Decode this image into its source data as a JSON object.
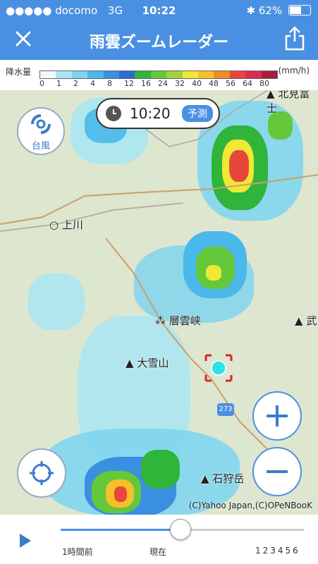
{
  "status": {
    "carrier": "●●●●● docomo",
    "network": "3G",
    "time": "10:22",
    "battery": "62%",
    "battery_level": 0.62
  },
  "nav": {
    "title": "雨雲ズームレーダー"
  },
  "legend": {
    "label": "降水量",
    "unit": "(mm/h)",
    "ticks": [
      "0",
      "1",
      "2",
      "4",
      "8",
      "12",
      "16",
      "24",
      "32",
      "40",
      "48",
      "56",
      "64",
      "80"
    ],
    "colors": [
      "#f2f7ff",
      "#a8e6f5",
      "#7dd3f0",
      "#4ab8ea",
      "#3a8fe0",
      "#2f6ad6",
      "#2fb53a",
      "#64c83a",
      "#9ed43b",
      "#f0e834",
      "#f6c029",
      "#f08c22",
      "#e8463b",
      "#d92c4f",
      "#a61e3e"
    ]
  },
  "map": {
    "time": "10:20",
    "forecast_badge": "予測",
    "typhoon_label": "台風",
    "places": {
      "kamikawa": "上川",
      "sounkyo": "層雲峡",
      "daisetsuzan": "大雪山",
      "ishikaridake": "石狩岳",
      "kitami": "北見富士",
      "take": "武",
      "route": "273"
    },
    "copyright": "(C)Yahoo Japan,(C)OPeNBooK"
  },
  "timeline": {
    "past_label": "1時間前",
    "now_label": "現在",
    "hours_label": "123456",
    "position": 0.49
  }
}
